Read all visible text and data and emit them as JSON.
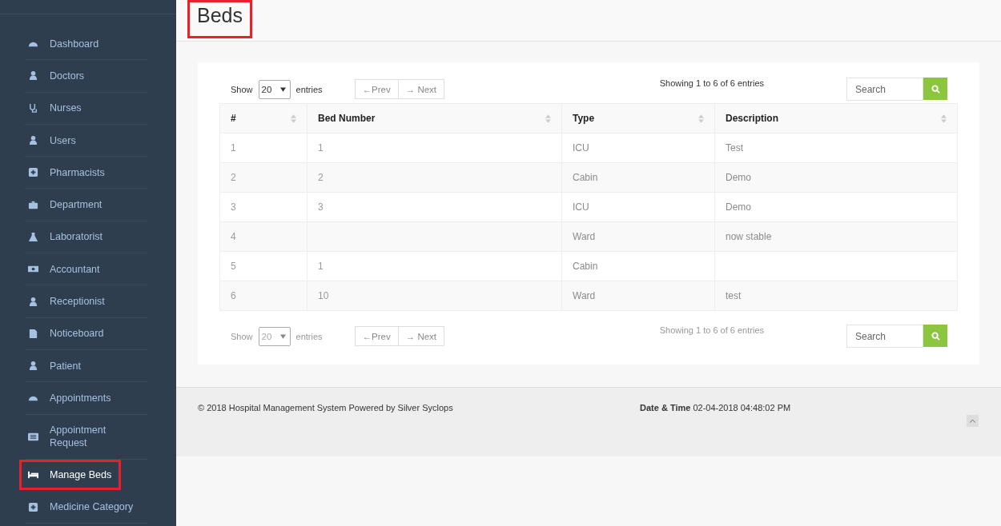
{
  "sidebar": {
    "items": [
      {
        "label": "Dashboard",
        "selected": false,
        "highlighted": false
      },
      {
        "label": "Doctors",
        "selected": false,
        "highlighted": false
      },
      {
        "label": "Nurses",
        "selected": false,
        "highlighted": false
      },
      {
        "label": "Users",
        "selected": false,
        "highlighted": false
      },
      {
        "label": "Pharmacists",
        "selected": false,
        "highlighted": false
      },
      {
        "label": "Department",
        "selected": false,
        "highlighted": false
      },
      {
        "label": "Laboratorist",
        "selected": false,
        "highlighted": false
      },
      {
        "label": "Accountant",
        "selected": false,
        "highlighted": false
      },
      {
        "label": "Receptionist",
        "selected": false,
        "highlighted": false
      },
      {
        "label": "Noticeboard",
        "selected": false,
        "highlighted": false
      },
      {
        "label": "Patient",
        "selected": false,
        "highlighted": false
      },
      {
        "label": "Appointments",
        "selected": false,
        "highlighted": false
      },
      {
        "label": "Appointment Request",
        "selected": false,
        "highlighted": false
      },
      {
        "label": "Manage Beds",
        "selected": true,
        "highlighted": true
      },
      {
        "label": "Medicine Category",
        "selected": false,
        "highlighted": false
      }
    ]
  },
  "page": {
    "title": "Beds",
    "title_highlighted": true
  },
  "controls": [
    {
      "show_label": "Show",
      "page_size": "20",
      "entries_label": "entries",
      "prev": "←Prev",
      "next": "→ Next",
      "info": "Showing 1 to 6 of 6 entries",
      "search_placeholder": "Search"
    },
    {
      "show_label": "Show",
      "page_size": "20",
      "entries_label": "entries",
      "prev": "←Prev",
      "next": "→ Next",
      "info": "Showing 1 to 6 of 6 entries",
      "search_placeholder": "Search"
    }
  ],
  "table": {
    "columns": [
      "#",
      "Bed Number",
      "Type",
      "Description"
    ],
    "rows": [
      [
        "1",
        "1",
        "ICU",
        "Test"
      ],
      [
        "2",
        "2",
        "Cabin",
        "Demo"
      ],
      [
        "3",
        "3",
        "ICU",
        "Demo"
      ],
      [
        "4",
        "",
        "Ward",
        "now stable"
      ],
      [
        "5",
        "1",
        "Cabin",
        ""
      ],
      [
        "6",
        "10",
        "Ward",
        "test"
      ]
    ]
  },
  "footer": {
    "copyright": "© 2018 Hospital Management System Powered by Silver Syclops",
    "datetime_label": "Date & Time",
    "datetime": "02-04-2018 04:48:02 PM"
  }
}
